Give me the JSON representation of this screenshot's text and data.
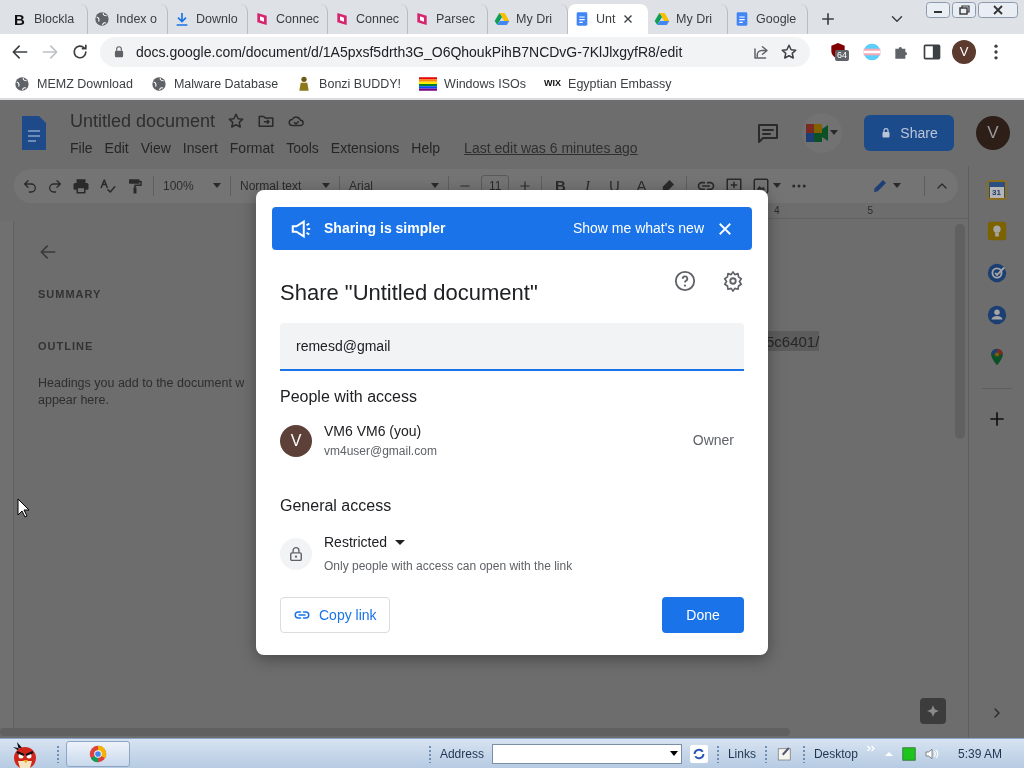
{
  "browser": {
    "tabs": [
      {
        "title": "Blockla",
        "kind": "letter",
        "icon_text": "B",
        "selected": false
      },
      {
        "title": "Index o",
        "kind": "globe",
        "selected": false
      },
      {
        "title": "Downlo",
        "kind": "download",
        "selected": false
      },
      {
        "title": "Connec",
        "kind": "app",
        "selected": false
      },
      {
        "title": "Connec",
        "kind": "app",
        "selected": false
      },
      {
        "title": "Parsec",
        "kind": "app",
        "selected": false
      },
      {
        "title": "My Dri",
        "kind": "drive",
        "selected": false
      },
      {
        "title": "Unt",
        "kind": "docs",
        "selected": true
      },
      {
        "title": "My Dri",
        "kind": "drive",
        "selected": false
      },
      {
        "title": "Google",
        "kind": "docs",
        "selected": false
      }
    ],
    "url": "docs.google.com/document/d/1A5pxsf5drth3G_O6QhoukPihB7NCDvG-7KlJlxgyfR8/edit",
    "extension_badge": "64",
    "profile_initial": "V",
    "bookmarks": [
      {
        "label": "MEMZ Download",
        "kind": "globe"
      },
      {
        "label": "Malware Database",
        "kind": "globe"
      },
      {
        "label": "Bonzi BUDDY!",
        "kind": "figure"
      },
      {
        "label": "Windows ISOs",
        "kind": "flag"
      },
      {
        "label": "Egyptian Embassy",
        "kind": "text",
        "icon_text": "WIX"
      }
    ]
  },
  "docs": {
    "title": "Untitled document",
    "menu": [
      "File",
      "Edit",
      "View",
      "Insert",
      "Format",
      "Tools",
      "Extensions",
      "Help"
    ],
    "last_edit": "Last edit was 6 minutes ago",
    "share_label": "Share",
    "avatar_initial": "V",
    "toolbar": {
      "zoom": "100%",
      "style": "Normal text",
      "font": "Arial",
      "font_size": "11",
      "format_buttons": [
        "B",
        "I",
        "U",
        "A"
      ]
    },
    "outline": {
      "summary": "SUMMARY",
      "outline": "OUTLINE",
      "hint": [
        "Headings you add to the document w",
        "appear here."
      ]
    },
    "ruler_numbers": [
      "4",
      "5"
    ],
    "page_text": "5c6401/",
    "calendar_label": "31"
  },
  "share_dialog": {
    "banner": {
      "text": "Sharing is simpler",
      "action": "Show me what's new"
    },
    "title": "Share \"Untitled document\"",
    "invite_value": "remesd@gmail",
    "people_heading": "People with access",
    "people": [
      {
        "initial": "V",
        "name": "VM6 VM6 (you)",
        "email": "vm4user@gmail.com",
        "role": "Owner"
      }
    ],
    "general_heading": "General access",
    "access": {
      "level": "Restricted",
      "description": "Only people with access can open with the link"
    },
    "copy_link": "Copy link",
    "done": "Done"
  },
  "taskbar": {
    "address_label": "Address",
    "links": "Links",
    "desktop": "Desktop",
    "clock": "5:39 AM"
  }
}
